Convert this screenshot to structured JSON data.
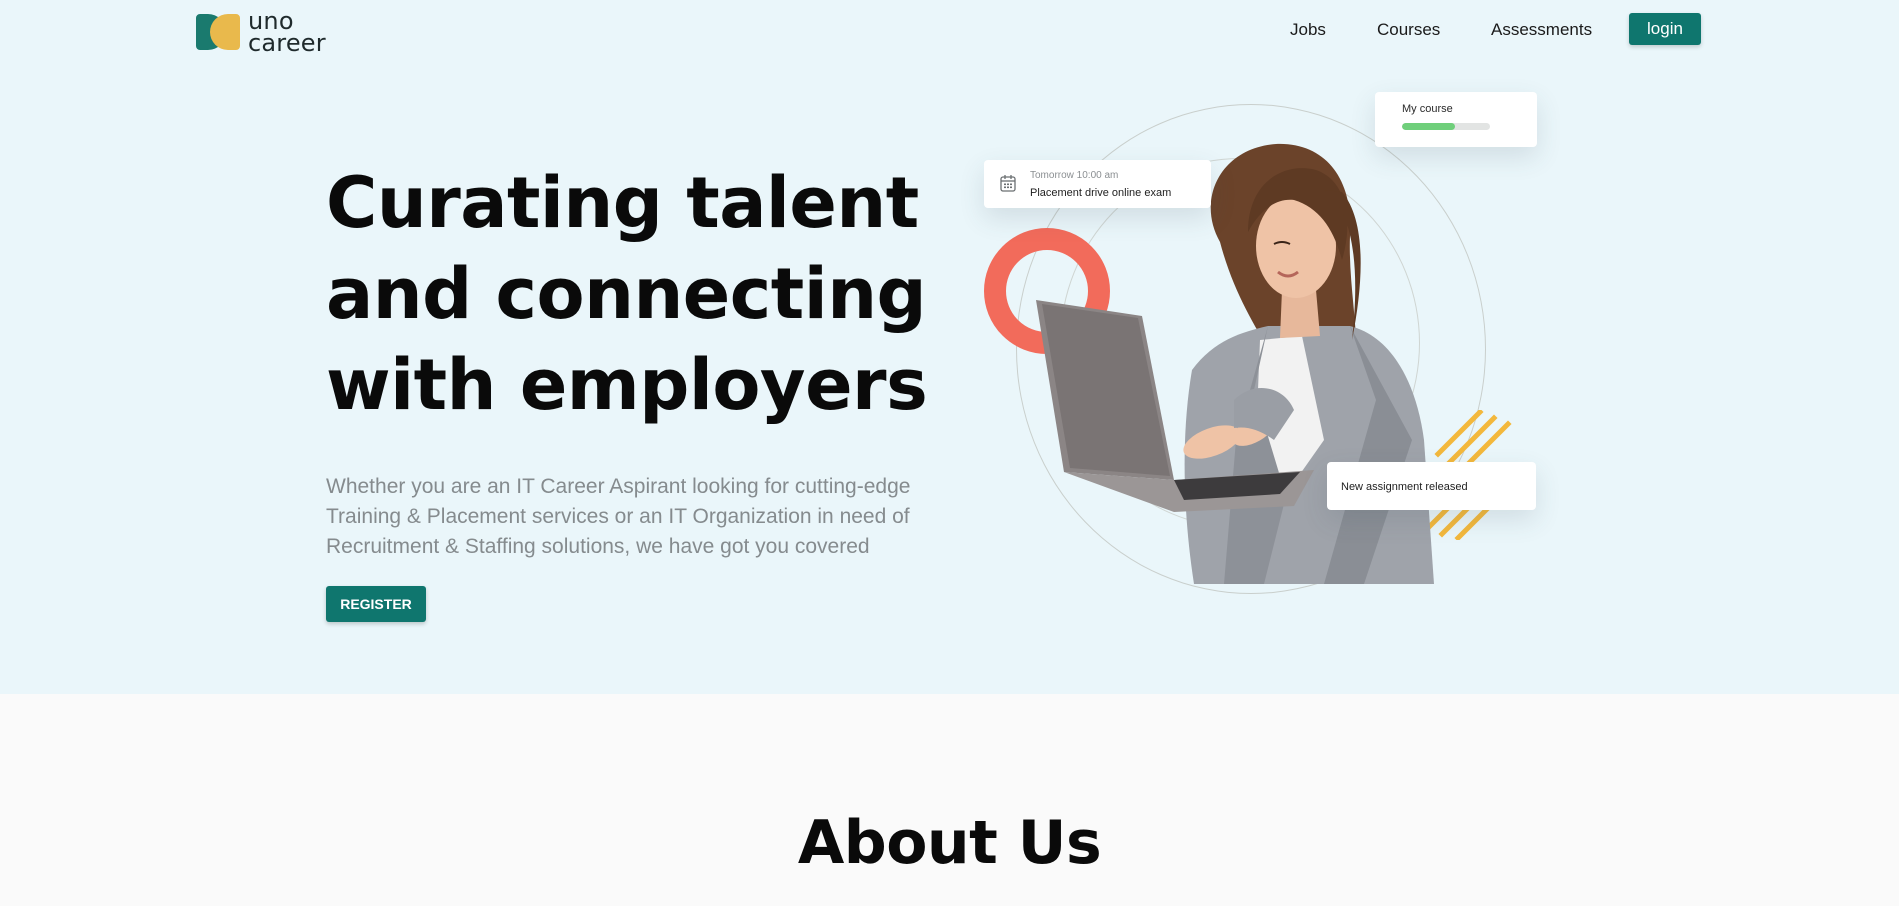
{
  "header": {
    "logo": {
      "line1": "uno",
      "line2": "career"
    },
    "nav": [
      {
        "label": "Jobs"
      },
      {
        "label": "Courses"
      },
      {
        "label": "Assessments"
      }
    ],
    "login_label": "login"
  },
  "hero": {
    "headline": [
      "Curating talent",
      "and connecting",
      "with employers"
    ],
    "lead": "Whether you are an IT Career Aspirant looking for cutting-edge Training & Placement services or an IT Organization in need of Recruitment & Staffing solutions, we have got you covered",
    "register_label": "REGISTER"
  },
  "cards": {
    "course": {
      "label": "My course",
      "progress": 0.6
    },
    "exam": {
      "time": "Tomorrow 10:00 am",
      "title": "Placement drive online exam",
      "icon": "calendar-icon"
    },
    "assignment": {
      "text": "New assignment released"
    }
  },
  "about": {
    "title": "About Us"
  },
  "colors": {
    "hero_bg": "#eaf6fa",
    "page_bg": "#fafafa",
    "accent": "#0f766e",
    "logo_yellow": "#e9b94c",
    "ring": "#f26b5b",
    "stripes": "#f3b83c",
    "progress": "#6fcf7b"
  }
}
